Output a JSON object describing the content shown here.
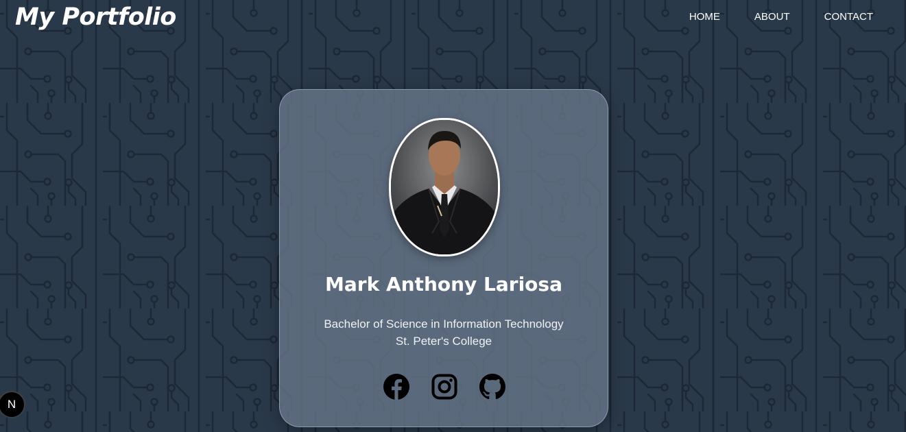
{
  "header": {
    "logo": "My Portfolio",
    "nav": [
      "HOME",
      "ABOUT",
      "CONTACT"
    ]
  },
  "profile": {
    "name": "Mark Anthony Lariosa",
    "degree": "Bachelor of Science in Information Technology",
    "school": "St. Peter's College"
  },
  "socials": [
    "facebook-icon",
    "instagram-icon",
    "github-icon"
  ],
  "dev_badge": {
    "letter": "N",
    "icon": "nextjs-icon"
  },
  "colors": {
    "background": "#2a394a",
    "circuit": "#1f2b38",
    "card": "#5e6d7e",
    "text": "#ffffff",
    "icons": "#000000"
  }
}
